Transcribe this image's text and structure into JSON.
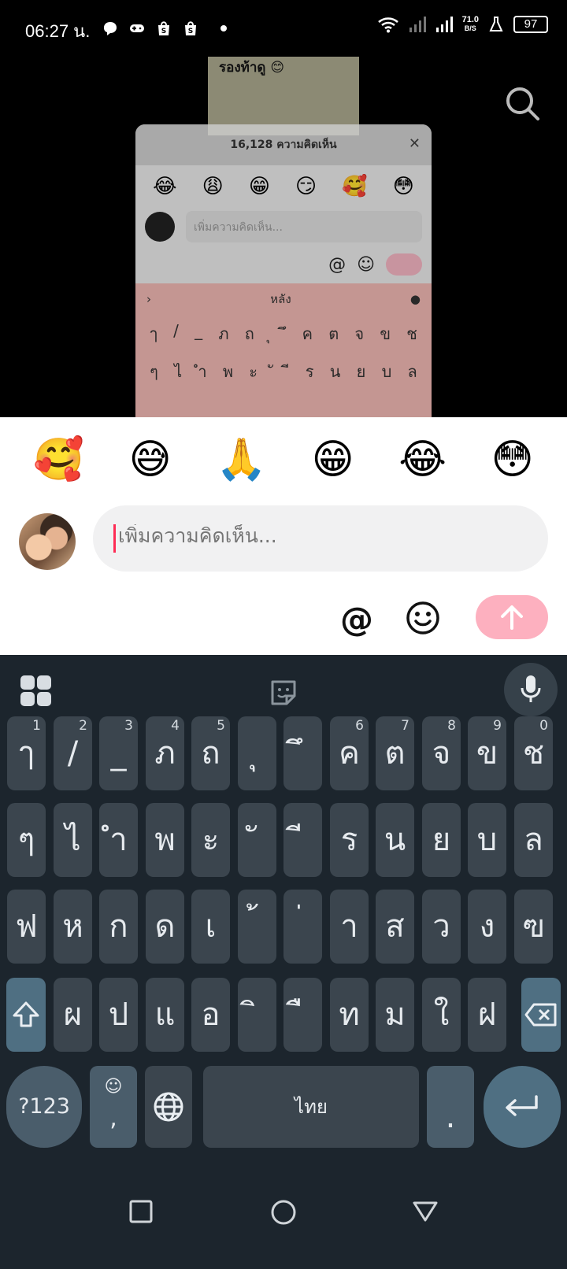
{
  "status_bar": {
    "time": "06:27 น.",
    "speed_value": "71.0",
    "speed_unit": "B/S",
    "battery": "97"
  },
  "background": {
    "video_title": "รองท้าดู 😊",
    "mini_header": "16,128 ความคิดเห็น",
    "mini_close": "✕",
    "mini_emojis": [
      "😂",
      "😩",
      "😁",
      "😏",
      "🥰",
      "😳"
    ],
    "mini_placeholder": "เพิ่มความคิดเห็น...",
    "mini_at": "@",
    "mini_smile": "☺",
    "mini_suggestion": "หลัง",
    "mini_row1": [
      "ๅ",
      "/",
      "_",
      "ภ",
      "ถ",
      "ุ",
      "ึ",
      "ค",
      "ต",
      "จ",
      "ข",
      "ช"
    ],
    "mini_row2": [
      "ๆ",
      "ไ",
      "ำ",
      "พ",
      "ะ",
      "ั",
      "ี",
      "ร",
      "น",
      "ย",
      "บ",
      "ล"
    ]
  },
  "comment_panel": {
    "emojis": [
      "🥰",
      "😅",
      "🙏",
      "😁",
      "😂",
      "😳"
    ],
    "placeholder": "เพิ่มความคิดเห็น...",
    "at_symbol": "@",
    "send_color": "#fdb0bf"
  },
  "keyboard": {
    "row1": [
      {
        "label": "ๅ",
        "num": "1"
      },
      {
        "label": "/",
        "num": "2"
      },
      {
        "label": "_",
        "num": "3"
      },
      {
        "label": "ภ",
        "num": "4"
      },
      {
        "label": "ถ",
        "num": "5"
      },
      {
        "label": "ุ",
        "num": ""
      },
      {
        "label": "ึ",
        "num": ""
      },
      {
        "label": "ค",
        "num": "6"
      },
      {
        "label": "ต",
        "num": "7"
      },
      {
        "label": "จ",
        "num": "8"
      },
      {
        "label": "ข",
        "num": "9"
      },
      {
        "label": "ช",
        "num": "0"
      }
    ],
    "row2": [
      "ๆ",
      "ไ",
      "ำ",
      "พ",
      "ะ",
      "ั",
      "ี",
      "ร",
      "น",
      "ย",
      "บ",
      "ล"
    ],
    "row3": [
      "ฟ",
      "ห",
      "ก",
      "ด",
      "เ",
      "้",
      "่",
      "า",
      "ส",
      "ว",
      "ง",
      "ฃ"
    ],
    "row4": [
      "ผ",
      "ป",
      "แ",
      "อ",
      "ิ",
      "ื",
      "ท",
      "ม",
      "ใ",
      "ฝ"
    ],
    "symbols_label": "?123",
    "emoji_comma_top": "☺",
    "emoji_comma_bottom": ",",
    "space_label": "ไทย",
    "period_label": ".",
    "accent_color": "#4f6f82"
  }
}
